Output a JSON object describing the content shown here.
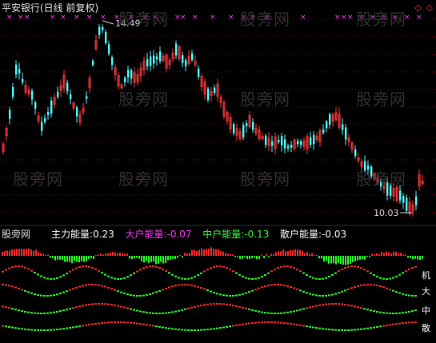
{
  "window": {
    "title": "平安银行(日线 前复权)",
    "toolbar_up": "◇",
    "toolbar_down": "◇"
  },
  "watermark": "股旁网",
  "main_chart": {
    "high_label": "14.49",
    "low_label": "10.03",
    "up_color": "#ff3b3b",
    "down_color": "#54ffff",
    "marker_color": "#ff3bff"
  },
  "sub_panel": {
    "label": "股旁网",
    "indicators": [
      {
        "name": "主力能量",
        "value": "0.23",
        "color": "#ffffff"
      },
      {
        "name": "大户能量",
        "value": "-0.07",
        "color": "#ff3bff"
      },
      {
        "name": "中户能量",
        "value": "-0.13",
        "color": "#3bff3b"
      },
      {
        "name": "散户能量",
        "value": "-0.03",
        "color": "#ffffff"
      }
    ],
    "right_labels": [
      "机",
      "大",
      "中",
      "散"
    ]
  }
}
